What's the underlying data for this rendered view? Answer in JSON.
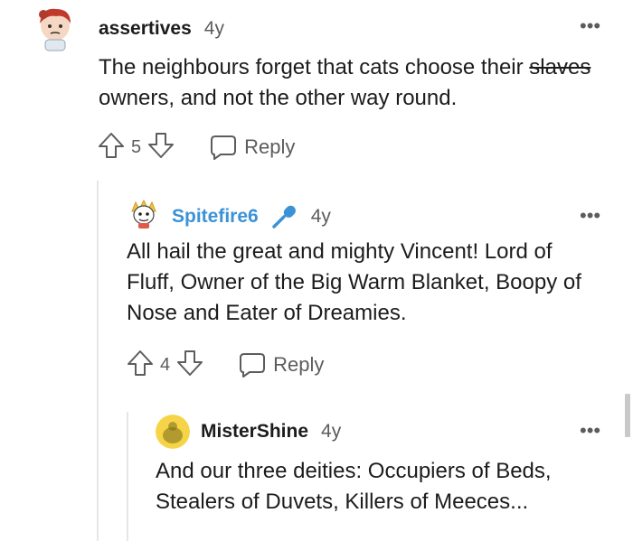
{
  "comments": [
    {
      "username": "assertives",
      "age": "4y",
      "body_before": "The neighbours forget that cats choose their ",
      "body_strike": "slaves",
      "body_after": " owners, and not the other way round.",
      "votes": "5",
      "reply_label": "Reply"
    },
    {
      "username": "Spitefire6",
      "age": "4y",
      "body": "All hail the great and mighty Vincent! Lord of Fluff, Owner of the Big Warm Blanket, Boopy of Nose and Eater of Dreamies.",
      "votes": "4",
      "reply_label": "Reply"
    },
    {
      "username": "MisterShine",
      "age": "4y",
      "body": "And our three deities: Occupiers of Beds, Stealers of Duvets, Killers of Meeces..."
    }
  ],
  "colors": {
    "op_username": "#3b92d6",
    "thread_line": "#e4e6e8",
    "muted": "#5c5c5c"
  }
}
